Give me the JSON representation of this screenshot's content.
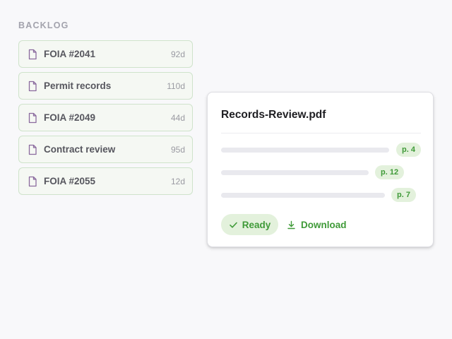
{
  "backlog": {
    "heading": "BACKLOG",
    "items": [
      {
        "label": "FOIA #2041",
        "age": "92d"
      },
      {
        "label": "Permit records",
        "age": "110d"
      },
      {
        "label": "FOIA #2049",
        "age": "44d"
      },
      {
        "label": "Contract review",
        "age": "95d"
      },
      {
        "label": "FOIA #2055",
        "age": "12d"
      }
    ]
  },
  "document": {
    "title": "Records-Review.pdf",
    "references": [
      {
        "page": "p. 4"
      },
      {
        "page": "p. 12"
      },
      {
        "page": "p. 7"
      }
    ],
    "status_label": "Ready",
    "download_label": "Download"
  },
  "icons": {
    "file": "file-icon",
    "check": "check-icon",
    "download": "download-icon"
  },
  "colors": {
    "accent_green": "#3f9a38",
    "badge_bg": "#e3f1dc",
    "item_border": "#cfe3cb",
    "file_icon": "#8a6a9e"
  }
}
